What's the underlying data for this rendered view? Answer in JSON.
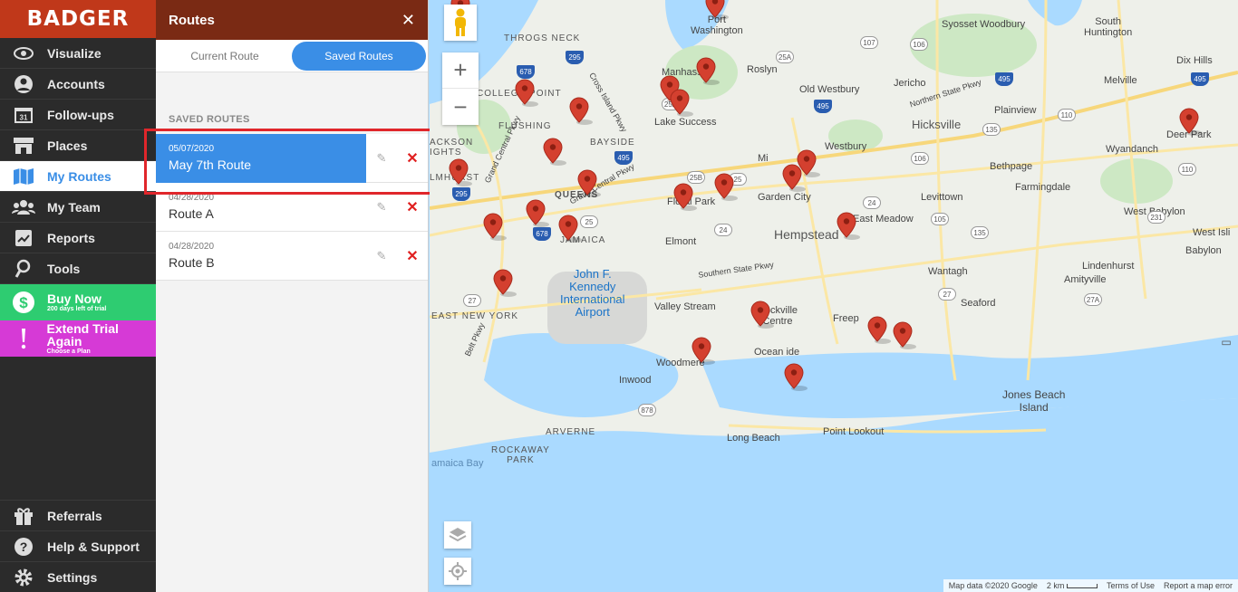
{
  "app": {
    "logo": "BADGER"
  },
  "sidebar": {
    "items": [
      {
        "label": "Visualize",
        "icon": "eye-icon"
      },
      {
        "label": "Accounts",
        "icon": "person-icon"
      },
      {
        "label": "Follow-ups",
        "icon": "calendar-icon",
        "badge": "31"
      },
      {
        "label": "Places",
        "icon": "store-icon"
      },
      {
        "label": "My Routes",
        "icon": "map-icon"
      },
      {
        "label": "My Team",
        "icon": "team-icon"
      },
      {
        "label": "Reports",
        "icon": "reports-icon"
      },
      {
        "label": "Tools",
        "icon": "tools-icon"
      }
    ],
    "buy": {
      "label": "Buy Now",
      "sub": "200 days left of trial"
    },
    "extend": {
      "label": "Extend Trial Again",
      "sub": "Choose a Plan"
    },
    "bottom": [
      {
        "label": "Referrals",
        "icon": "gift-icon"
      },
      {
        "label": "Help & Support",
        "icon": "help-icon"
      },
      {
        "label": "Settings",
        "icon": "gear-icon"
      }
    ]
  },
  "routes_panel": {
    "title": "Routes",
    "tabs": {
      "current": "Current Route",
      "saved": "Saved Routes"
    },
    "section_title": "SAVED ROUTES",
    "routes": [
      {
        "date": "05/07/2020",
        "name": "May 7th Route"
      },
      {
        "date": "04/28/2020",
        "name": "Route A"
      },
      {
        "date": "04/28/2020",
        "name": "Route B"
      }
    ]
  },
  "map": {
    "labels": {
      "port_washington": "Port\nWashington",
      "manhasset": "Manhasset",
      "roslyn": "Roslyn",
      "old_westbury": "Old Westbury",
      "jericho": "Jericho",
      "syosset_woodbury": "Syosset Woodbury",
      "south_huntington": "South\nHuntington",
      "dix_hills": "Dix Hills",
      "melville": "Melville",
      "hicksville": "Hicksville",
      "plainview": "Plainview",
      "deer_park": "Deer Park",
      "wyandanch": "Wyandanch",
      "bethpage": "Bethpage",
      "farmingdale": "Farmingdale",
      "levittown": "Levittown",
      "west_babylon": "West Babylon",
      "west_islip": "West Isli",
      "babylon": "Babylon",
      "lindenhurst": "Lindenhurst",
      "amityville": "Amityville",
      "wantagh": "Wantagh",
      "seaford": "Seaford",
      "hempstead": "Hempstead",
      "east_meadow": "East Meadow",
      "garden_city": "Garden City",
      "westbury": "Westbury",
      "mineola": "Mi",
      "floral_park": "Floral Park",
      "elmont": "Elmont",
      "valley_stream": "Valley Stream",
      "rockville_centre": "Rockville\nCentre",
      "oceanside": "Ocean ide",
      "freeport": "Freep",
      "woodmere": "Woodmere",
      "inwood": "Inwood",
      "long_beach": "Long Beach",
      "point_lookout": "Point Lookout",
      "jones_beach": "Jones Beach\nIsland",
      "queens": "QUEENS",
      "jamaica": "JAMAICA",
      "bayside": "BAYSIDE",
      "flushing": "FLUSHING",
      "college_point": "COLLEGE POINT",
      "throgs_neck": "THROGS NECK",
      "east_new_york": "EAST NEW YORK",
      "arverne": "ARVERNE",
      "rockaway_park": "ROCKAWAY\nPARK",
      "jamaica_bay": "amaica Bay",
      "jfk": "John F.\nKennedy\nInternational\nAirport",
      "lake_success": "Lake Success",
      "jackson_heights": "ACKSON\nIGHTS",
      "elmhurst": "LMHURST",
      "northern_state": "Northern State Pkwy",
      "southern_state": "Southern State Pkwy",
      "grand_central": "Grand Central Pkwy",
      "belt_pkwy": "Belt Pkwy",
      "cross_island": "Cross Island Pkwy",
      "grand_central2": "Grand Central Pkwy"
    },
    "shields": [
      "107",
      "106",
      "25A",
      "25A",
      "495",
      "495",
      "106",
      "110",
      "135",
      "495",
      "110",
      "24",
      "105",
      "135",
      "27",
      "27A",
      "231",
      "25B",
      "25",
      "24",
      "25",
      "678",
      "295",
      "678",
      "878",
      "27",
      "495",
      "295"
    ],
    "attribution": {
      "data": "Map data ©2020 Google",
      "scale": "2 km",
      "terms": "Terms of Use",
      "report": "Report a map error"
    }
  }
}
